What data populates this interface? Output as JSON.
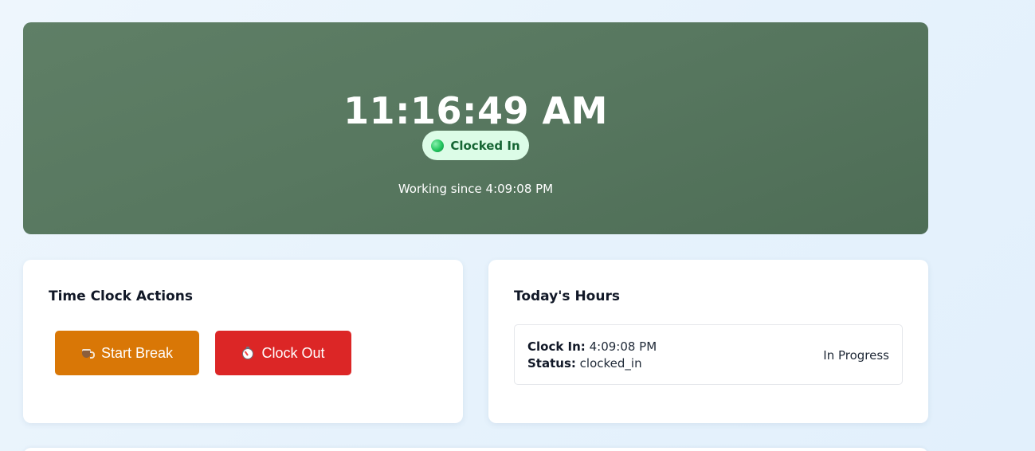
{
  "clock": {
    "time": "11:16:49 AM",
    "status_label": "Clocked In",
    "working_since": "Working since 4:09:08 PM"
  },
  "actions": {
    "title": "Time Clock Actions",
    "break_label": "Start Break",
    "break_icon": "coffee-icon",
    "clock_out_label": "Clock Out",
    "clock_out_icon": "stopwatch-icon"
  },
  "today": {
    "title": "Today's Hours",
    "entries": [
      {
        "clock_in_label": "Clock In:",
        "clock_in_value": "4:09:08 PM",
        "status_label": "Status:",
        "status_value": "clocked_in",
        "state": "In Progress"
      }
    ]
  },
  "colors": {
    "hero": "#587860",
    "status_pill_bg": "#dcfce7",
    "status_pill_text": "#166534",
    "break_button": "#d97706",
    "clock_out_button": "#dc2626"
  }
}
